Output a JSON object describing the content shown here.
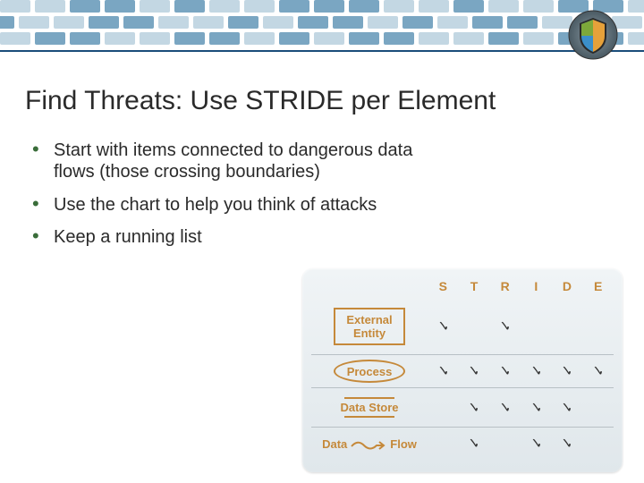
{
  "title": "Find Threats: Use STRIDE per Element",
  "bullets": [
    "Start with items connected to dangerous data flows (those crossing boundaries)",
    "Use the chart to help you think of attacks",
    "Keep a running list"
  ],
  "stride": {
    "columns": [
      "S",
      "T",
      "R",
      "I",
      "D",
      "E"
    ],
    "rows": [
      {
        "label": "External Entity",
        "deco": "box",
        "marks": [
          true,
          false,
          true,
          false,
          false,
          false
        ]
      },
      {
        "label": "Process",
        "deco": "oval",
        "marks": [
          true,
          true,
          true,
          true,
          true,
          true
        ]
      },
      {
        "label": "Data Store",
        "deco": "lines",
        "marks": [
          false,
          true,
          true,
          true,
          true,
          false
        ]
      },
      {
        "label": "Data Flow",
        "deco": "wave",
        "marks": [
          false,
          true,
          false,
          true,
          true,
          false
        ]
      }
    ]
  },
  "checkmark": "✓"
}
